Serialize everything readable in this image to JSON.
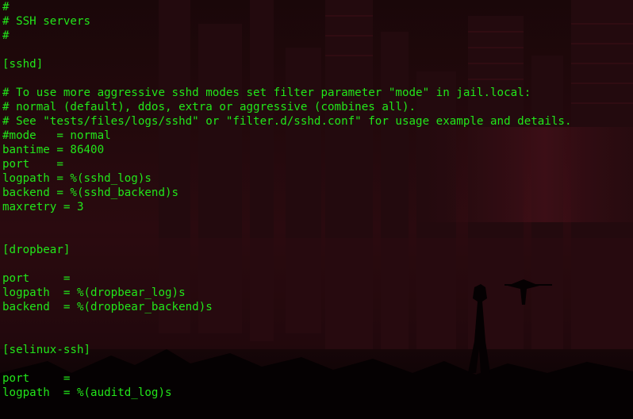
{
  "terminal": {
    "text_color": "#22e61a",
    "background_color": "#120608",
    "lines": [
      "#",
      "# SSH servers",
      "#",
      "",
      "[sshd]",
      "",
      "# To use more aggressive sshd modes set filter parameter \"mode\" in jail.local:",
      "# normal (default), ddos, extra or aggressive (combines all).",
      "# See \"tests/files/logs/sshd\" or \"filter.d/sshd.conf\" for usage example and details.",
      "#mode   = normal",
      "bantime = 86400",
      "port    =",
      "logpath = %(sshd_log)s",
      "backend = %(sshd_backend)s",
      "maxretry = 3",
      "",
      "",
      "[dropbear]",
      "",
      "port     =",
      "logpath  = %(dropbear_log)s",
      "backend  = %(dropbear_backend)s",
      "",
      "",
      "[selinux-ssh]",
      "",
      "port     =",
      "logpath  = %(auditd_log)s"
    ]
  }
}
